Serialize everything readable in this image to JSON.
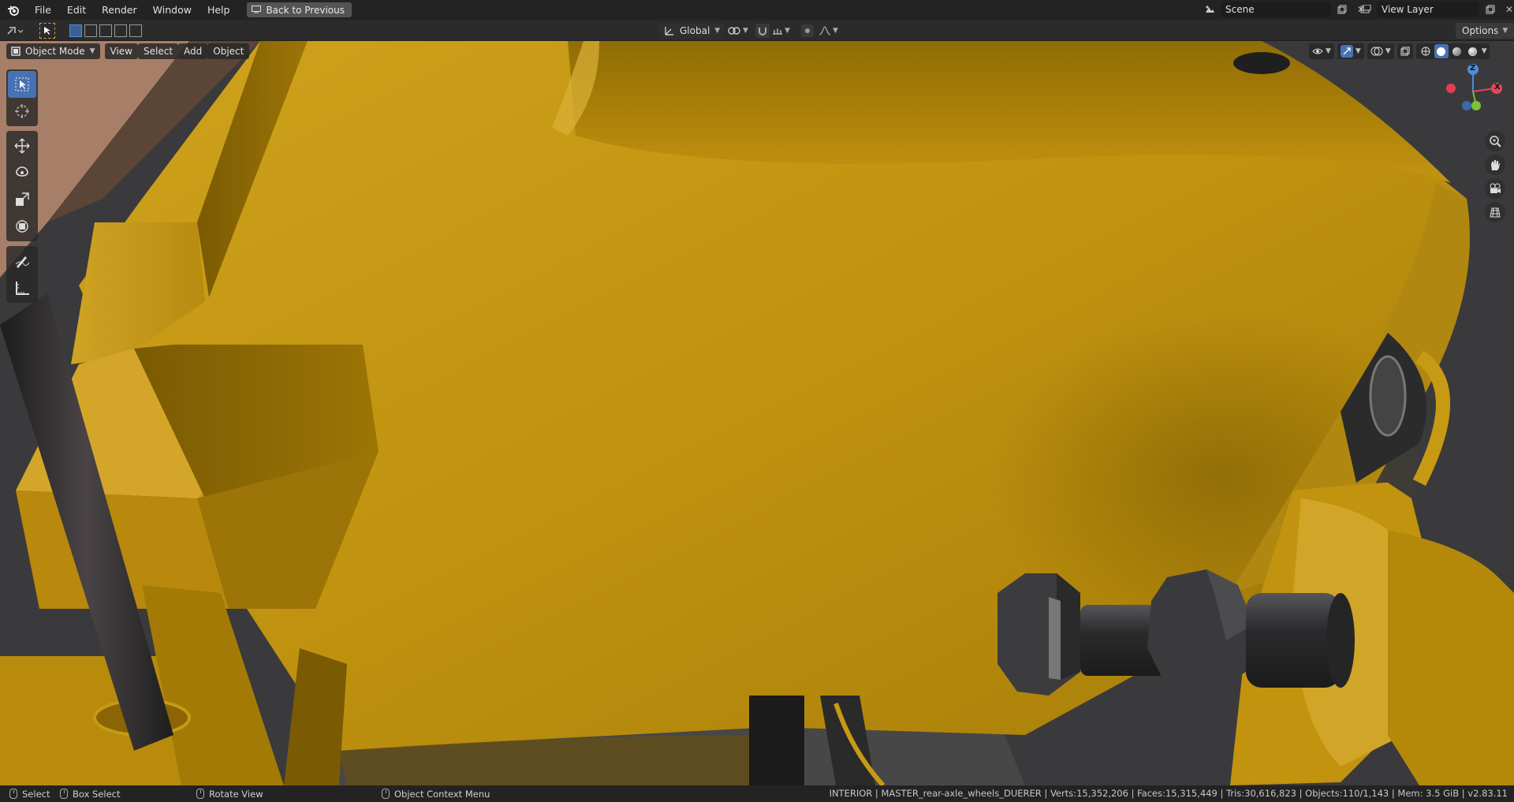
{
  "topbar": {
    "menu": [
      "File",
      "Edit",
      "Render",
      "Window",
      "Help"
    ],
    "back_button": "Back to Previous",
    "scene_name": "Scene",
    "view_layer_name": "View Layer"
  },
  "toolheader": {
    "orientation": "Global",
    "options_label": "Options"
  },
  "viewport": {
    "mode": "Object Mode",
    "menus": [
      "View",
      "Select",
      "Add",
      "Object"
    ],
    "gizmo": {
      "x": "X",
      "y": "Y",
      "z": "Z"
    }
  },
  "statusbar": {
    "select": "Select",
    "box_select": "Box Select",
    "rotate_view": "Rotate View",
    "context_menu": "Object Context Menu",
    "stats": "INTERIOR | MASTER_rear-axle_wheels_DUERER | Verts:15,352,206 | Faces:15,315,449 | Tris:30,616,823 | Objects:110/1,143 | Mem: 3.5 GiB | v2.83.11"
  },
  "colors": {
    "accent": "#4772b3",
    "mustard": "#c79a14",
    "metal": "#3a3a3c"
  }
}
